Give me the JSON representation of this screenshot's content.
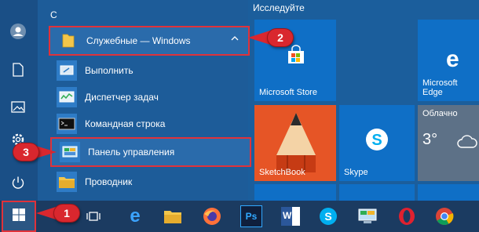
{
  "app_list": {
    "letter": "С",
    "items": [
      {
        "label": "Служебные — Windows",
        "icon": "folder-icon",
        "expanded": true
      },
      {
        "label": "Выполнить",
        "icon": "run-icon"
      },
      {
        "label": "Диспетчер задач",
        "icon": "task-manager-icon"
      },
      {
        "label": "Командная строка",
        "icon": "cmd-icon"
      },
      {
        "label": "Панель управления",
        "icon": "control-panel-icon"
      },
      {
        "label": "Проводник",
        "icon": "explorer-folder-icon"
      }
    ]
  },
  "tiles": {
    "section_title": "Исследуйте",
    "items": [
      {
        "label": "Microsoft Store",
        "icon": "store-icon"
      },
      {
        "label": "Microsoft Edge",
        "icon": "edge-icon"
      },
      {
        "label": "SketchBook",
        "icon": "pencil-icon"
      },
      {
        "label": "Skype",
        "icon": "skype-icon"
      },
      {
        "label": "Облачно",
        "temp": "3°",
        "icon": "weather-cloud-icon"
      }
    ]
  },
  "taskbar": {
    "items": [
      "start-icon",
      "task-view-icon",
      "edge-icon",
      "file-explorer-icon",
      "firefox-icon",
      "photoshop-icon",
      "word-icon",
      "skype-icon",
      "control-panel-icon",
      "opera-icon",
      "chrome-icon"
    ],
    "photoshop_label": "Ps",
    "word_label": "W"
  },
  "callouts": [
    "1",
    "2",
    "3"
  ],
  "colors": {
    "highlight": "#e0323a",
    "tile": "#0f6fc6",
    "taskbar": "#1b3b61"
  }
}
